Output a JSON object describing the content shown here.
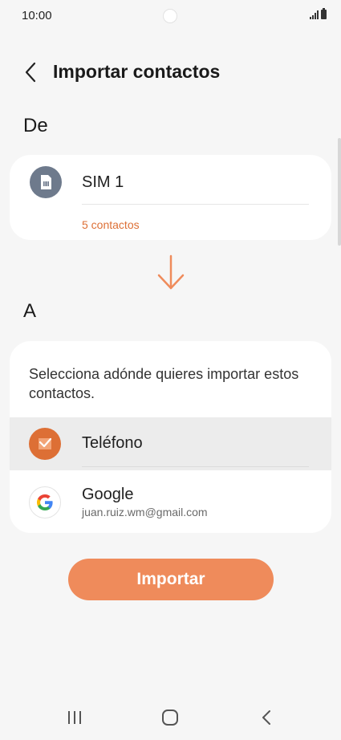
{
  "status_bar": {
    "time": "10:00"
  },
  "header": {
    "title": "Importar contactos"
  },
  "source": {
    "section_label": "De",
    "sim_name": "SIM 1",
    "contact_count": "5 contactos"
  },
  "destination": {
    "section_label": "A",
    "description": "Selecciona adónde quieres importar estos contactos.",
    "options": [
      {
        "title": "Teléfono",
        "subtitle": "",
        "selected": true
      },
      {
        "title": "Google",
        "subtitle": "juan.ruiz.wm@gmail.com",
        "selected": false
      }
    ]
  },
  "import_button": {
    "label": "Importar"
  },
  "colors": {
    "accent": "#dd6f35",
    "button": "#ef8b5b",
    "sim_icon_bg": "#6e7a8c",
    "background": "#f6f6f6"
  },
  "icons": [
    "signal-icon",
    "battery-icon",
    "back-arrow-icon",
    "sim-card-icon",
    "arrow-down-icon",
    "phone-check-icon",
    "google-g-icon",
    "recent-apps-icon",
    "home-icon",
    "back-icon"
  ]
}
